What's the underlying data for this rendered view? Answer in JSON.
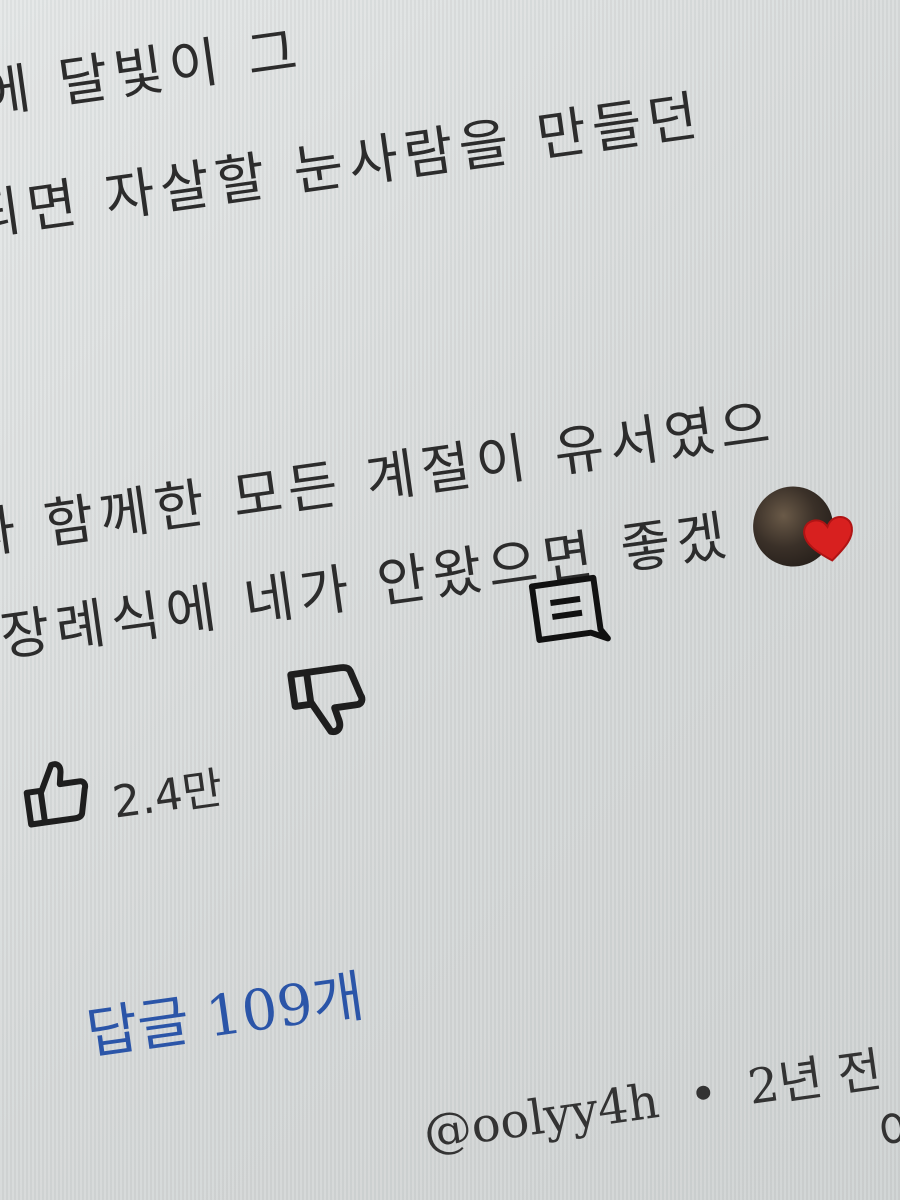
{
  "comment": {
    "lines": [
      "위에 달빛이 그",
      "되면 자살할 눈사람을 만들던",
      "계절이 유서였으",
      "와 함께한 모든 계절이 유서였으",
      "장례식에 네가 안왔으면 좋겠"
    ]
  },
  "actions": {
    "like_count": "2.4만"
  },
  "replies": {
    "label": "답글 109개"
  },
  "next_comment": {
    "author": "@oolyy4h",
    "separator": "•",
    "time": "2년 전",
    "text_fragment": "이"
  },
  "colors": {
    "link": "#2b55a8",
    "heart": "#d8201f",
    "text": "#2c2c2c"
  },
  "icons": [
    "thumbs-up-icon",
    "thumbs-down-icon",
    "reply-icon",
    "avatar",
    "heart-icon"
  ]
}
